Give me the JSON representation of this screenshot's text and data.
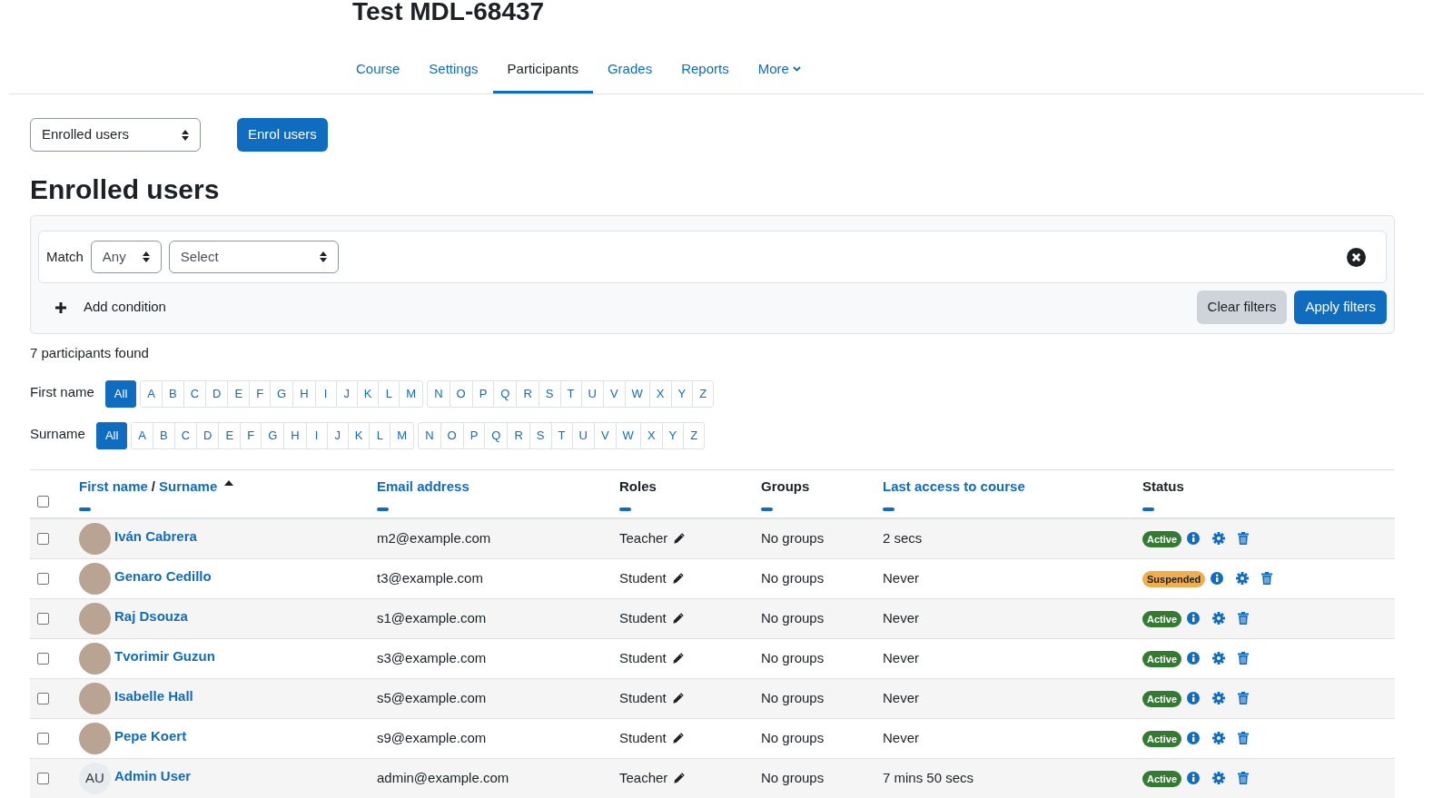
{
  "course_title": "Test MDL-68437",
  "tabs": [
    {
      "label": "Course",
      "selected": false
    },
    {
      "label": "Settings",
      "selected": false
    },
    {
      "label": "Participants",
      "selected": true
    },
    {
      "label": "Grades",
      "selected": false
    },
    {
      "label": "Reports",
      "selected": false
    },
    {
      "label": "More",
      "selected": false,
      "dropdown": true
    }
  ],
  "view_select": {
    "value": "Enrolled users"
  },
  "enrol_button": "Enrol users",
  "heading": "Enrolled users",
  "filter": {
    "match_label": "Match",
    "match_value": "Any",
    "condition_value": "Select",
    "add_condition": "Add condition",
    "clear_button": "Clear filters",
    "apply_button": "Apply filters"
  },
  "found": "7 participants found",
  "initials_bars": [
    {
      "label": "First name",
      "groups": [
        [
          {
            "label": "All",
            "selected": true
          },
          {
            "label": "A",
            "selected": false
          },
          {
            "label": "B",
            "selected": false
          },
          {
            "label": "C",
            "selected": false
          },
          {
            "label": "D",
            "selected": false
          },
          {
            "label": "E",
            "selected": false
          },
          {
            "label": "F",
            "selected": false
          },
          {
            "label": "G",
            "selected": false
          },
          {
            "label": "H",
            "selected": false
          },
          {
            "label": "I",
            "selected": false
          },
          {
            "label": "J",
            "selected": false
          },
          {
            "label": "K",
            "selected": false
          },
          {
            "label": "L",
            "selected": false
          },
          {
            "label": "M",
            "selected": false
          }
        ],
        [
          {
            "label": "N",
            "selected": false
          },
          {
            "label": "O",
            "selected": false
          },
          {
            "label": "P",
            "selected": false
          },
          {
            "label": "Q",
            "selected": false
          },
          {
            "label": "R",
            "selected": false
          },
          {
            "label": "S",
            "selected": false
          },
          {
            "label": "T",
            "selected": false
          },
          {
            "label": "U",
            "selected": false
          },
          {
            "label": "V",
            "selected": false
          },
          {
            "label": "W",
            "selected": false
          },
          {
            "label": "X",
            "selected": false
          },
          {
            "label": "Y",
            "selected": false
          },
          {
            "label": "Z",
            "selected": false
          }
        ]
      ]
    },
    {
      "label": "Surname",
      "groups": [
        [
          {
            "label": "All",
            "selected": true
          },
          {
            "label": "A",
            "selected": false
          },
          {
            "label": "B",
            "selected": false
          },
          {
            "label": "C",
            "selected": false
          },
          {
            "label": "D",
            "selected": false
          },
          {
            "label": "E",
            "selected": false
          },
          {
            "label": "F",
            "selected": false
          },
          {
            "label": "G",
            "selected": false
          },
          {
            "label": "H",
            "selected": false
          },
          {
            "label": "I",
            "selected": false
          },
          {
            "label": "J",
            "selected": false
          },
          {
            "label": "K",
            "selected": false
          },
          {
            "label": "L",
            "selected": false
          },
          {
            "label": "M",
            "selected": false
          }
        ],
        [
          {
            "label": "N",
            "selected": false
          },
          {
            "label": "O",
            "selected": false
          },
          {
            "label": "P",
            "selected": false
          },
          {
            "label": "Q",
            "selected": false
          },
          {
            "label": "R",
            "selected": false
          },
          {
            "label": "S",
            "selected": false
          },
          {
            "label": "T",
            "selected": false
          },
          {
            "label": "U",
            "selected": false
          },
          {
            "label": "V",
            "selected": false
          },
          {
            "label": "W",
            "selected": false
          },
          {
            "label": "X",
            "selected": false
          },
          {
            "label": "Y",
            "selected": false
          },
          {
            "label": "Z",
            "selected": false
          }
        ]
      ]
    }
  ],
  "table": {
    "select_all_checked": false,
    "name_header": {
      "first": "First name",
      "separator": "/",
      "second": "Surname",
      "sorted": true
    },
    "columns": [
      {
        "label": "Email address",
        "kind": "link"
      },
      {
        "label": "Roles",
        "kind": "plain"
      },
      {
        "label": "Groups",
        "kind": "plain"
      },
      {
        "label": "Last access to course",
        "kind": "link"
      },
      {
        "label": "Status",
        "kind": "plain"
      }
    ],
    "rows": [
      {
        "checked": false,
        "avatar": {
          "kind": "photo"
        },
        "name": "Iván Cabrera",
        "email": "m2@example.com",
        "role": "Teacher",
        "groups": "No groups",
        "last_access": "2 secs",
        "status": {
          "label": "Active",
          "kind": "active"
        }
      },
      {
        "checked": false,
        "avatar": {
          "kind": "photo"
        },
        "name": "Genaro Cedillo",
        "email": "t3@example.com",
        "role": "Student",
        "groups": "No groups",
        "last_access": "Never",
        "status": {
          "label": "Suspended",
          "kind": "suspended"
        }
      },
      {
        "checked": false,
        "avatar": {
          "kind": "photo"
        },
        "name": "Raj Dsouza",
        "email": "s1@example.com",
        "role": "Student",
        "groups": "No groups",
        "last_access": "Never",
        "status": {
          "label": "Active",
          "kind": "active"
        }
      },
      {
        "checked": false,
        "avatar": {
          "kind": "photo"
        },
        "name": "Tvorimir Guzun",
        "email": "s3@example.com",
        "role": "Student",
        "groups": "No groups",
        "last_access": "Never",
        "status": {
          "label": "Active",
          "kind": "active"
        }
      },
      {
        "checked": false,
        "avatar": {
          "kind": "photo"
        },
        "name": "Isabelle Hall",
        "email": "s5@example.com",
        "role": "Student",
        "groups": "No groups",
        "last_access": "Never",
        "status": {
          "label": "Active",
          "kind": "active"
        }
      },
      {
        "checked": false,
        "avatar": {
          "kind": "photo"
        },
        "name": "Pepe Koert",
        "email": "s9@example.com",
        "role": "Student",
        "groups": "No groups",
        "last_access": "Never",
        "status": {
          "label": "Active",
          "kind": "active"
        }
      },
      {
        "checked": false,
        "avatar": {
          "kind": "initials",
          "initials": "AU"
        },
        "name": "Admin User",
        "email": "admin@example.com",
        "role": "Teacher",
        "groups": "No groups",
        "last_access": "7 mins 50 secs",
        "status": {
          "label": "Active",
          "kind": "active"
        }
      }
    ]
  }
}
